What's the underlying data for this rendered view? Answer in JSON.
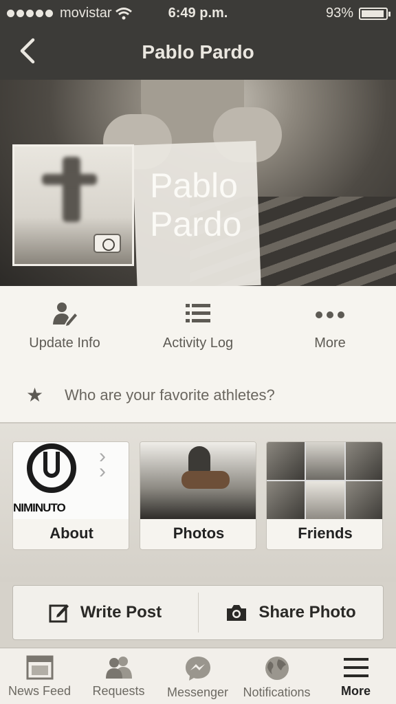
{
  "status_bar": {
    "carrier": "movistar",
    "time": "6:49 p.m.",
    "battery": "93%",
    "battery_level": 0.93
  },
  "nav": {
    "title": "Pablo Pardo"
  },
  "profile": {
    "name_line1": "Pablo",
    "name_line2": "Pardo"
  },
  "actions": [
    {
      "label": "Update Info",
      "icon": "person-edit-icon"
    },
    {
      "label": "Activity Log",
      "icon": "list-icon"
    },
    {
      "label": "More",
      "icon": "more-dots-icon"
    }
  ],
  "prompt": {
    "text": "Who are your favorite athletes?",
    "icon": "star-icon"
  },
  "tiles": {
    "about": {
      "label": "About",
      "logo_text": "NIMINUTO"
    },
    "photos": {
      "label": "Photos"
    },
    "friends": {
      "label": "Friends"
    }
  },
  "composer": {
    "write_post": "Write Post",
    "share_photo": "Share Photo"
  },
  "tabbar": [
    {
      "label": "News Feed",
      "icon": "news-feed-icon",
      "active": false
    },
    {
      "label": "Requests",
      "icon": "friend-requests-icon",
      "active": false
    },
    {
      "label": "Messenger",
      "icon": "messenger-icon",
      "active": false
    },
    {
      "label": "Notifications",
      "icon": "globe-icon",
      "active": false
    },
    {
      "label": "More",
      "icon": "hamburger-menu-icon",
      "active": true
    }
  ]
}
